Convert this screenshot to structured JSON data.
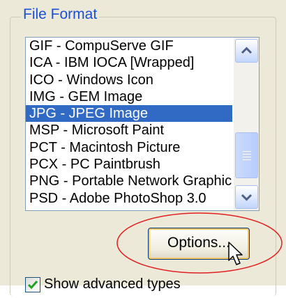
{
  "group": {
    "legend": "File Format"
  },
  "format_list": {
    "items": [
      "GIF - CompuServe GIF",
      "ICA - IBM IOCA [Wrapped]",
      "ICO - Windows Icon",
      "IMG - GEM Image",
      "JPG - JPEG Image",
      "MSP - Microsoft Paint",
      "PCT - Macintosh Picture",
      "PCX - PC Paintbrush",
      "PNG - Portable Network Graphics",
      "PSD - Adobe PhotoShop 3.0"
    ],
    "selected_index": 4,
    "selected_value": "JPG - JPEG Image"
  },
  "options_button": {
    "label": "Options..."
  },
  "advanced_types": {
    "label": "Show advanced types",
    "checked": true
  },
  "colors": {
    "selection": "#316ac5",
    "legend_text": "#1a4fd6",
    "highlight_ellipse": "#e02020"
  },
  "icons": [
    "scroll-up-arrow-icon",
    "scroll-down-arrow-icon",
    "checkmark-icon",
    "mouse-cursor-icon"
  ]
}
